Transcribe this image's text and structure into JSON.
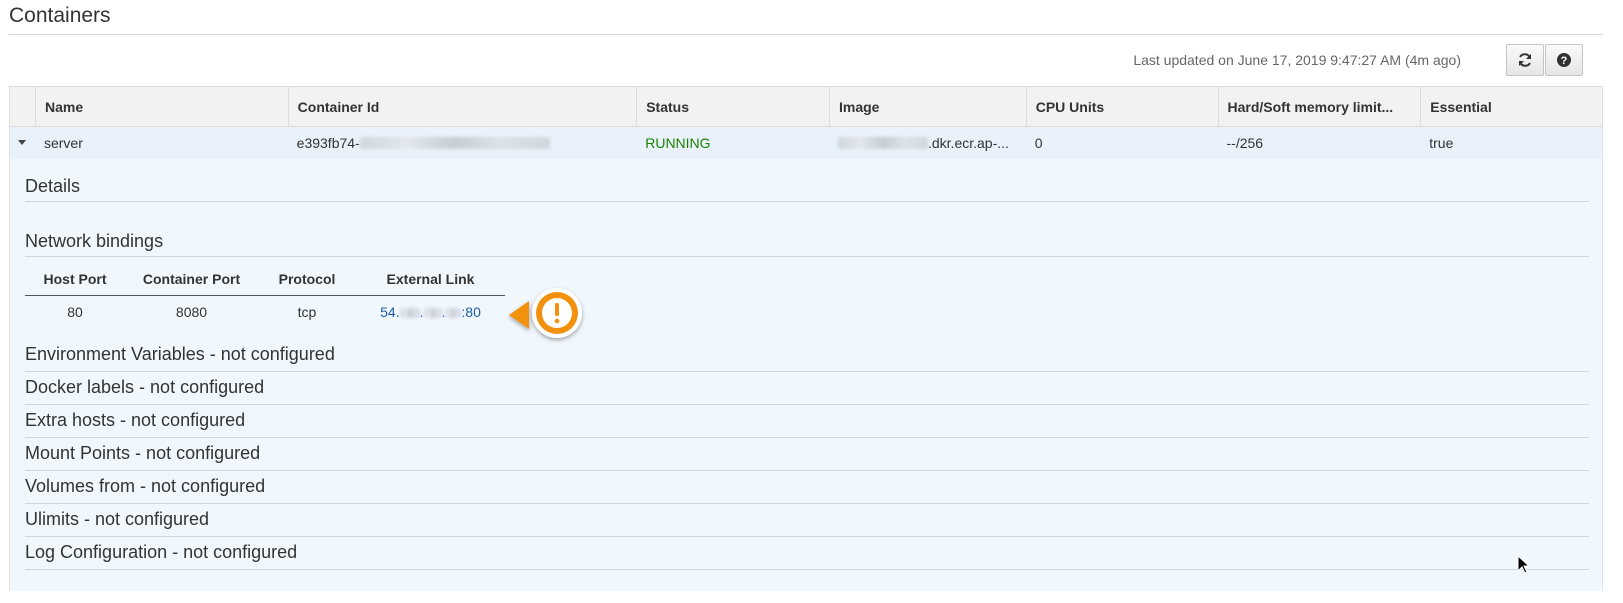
{
  "section_title": "Containers",
  "last_updated": "Last updated on June 17, 2019 9:47:27 AM (4m ago)",
  "icons": {
    "refresh": "refresh-icon",
    "help": "help-icon",
    "expand": "caret-down-icon",
    "warning": "exclamation-icon",
    "cursor": "mouse-pointer-icon"
  },
  "table": {
    "headers": [
      "Name",
      "Container Id",
      "Status",
      "Image",
      "CPU Units",
      "Hard/Soft memory limit...",
      "Essential"
    ],
    "row": {
      "name": "server",
      "container_id_prefix": "e393fb74-",
      "status": "RUNNING",
      "image_suffix": ".dkr.ecr.ap-...",
      "cpu_units": "0",
      "memory": "--/256",
      "essential": "true"
    }
  },
  "details": {
    "title": "Details",
    "network_title": "Network bindings",
    "network_headers": [
      "Host Port",
      "Container Port",
      "Protocol",
      "External Link"
    ],
    "network_row": {
      "host_port": "80",
      "container_port": "8080",
      "protocol": "tcp",
      "link_prefix": "54.",
      "link_sep1": ".",
      "link_sep2": ".",
      "link_suffix": ":80"
    },
    "config_sections": [
      "Environment Variables - not configured",
      "Docker labels - not configured",
      "Extra hosts - not configured",
      "Mount Points - not configured",
      "Volumes from - not configured",
      "Ulimits - not configured",
      "Log Configuration - not configured"
    ]
  },
  "colors": {
    "accent_orange": "#f29111",
    "running_green": "#1d8102",
    "link_blue": "#1f5ba8",
    "row_highlight": "#e9f2fb"
  }
}
